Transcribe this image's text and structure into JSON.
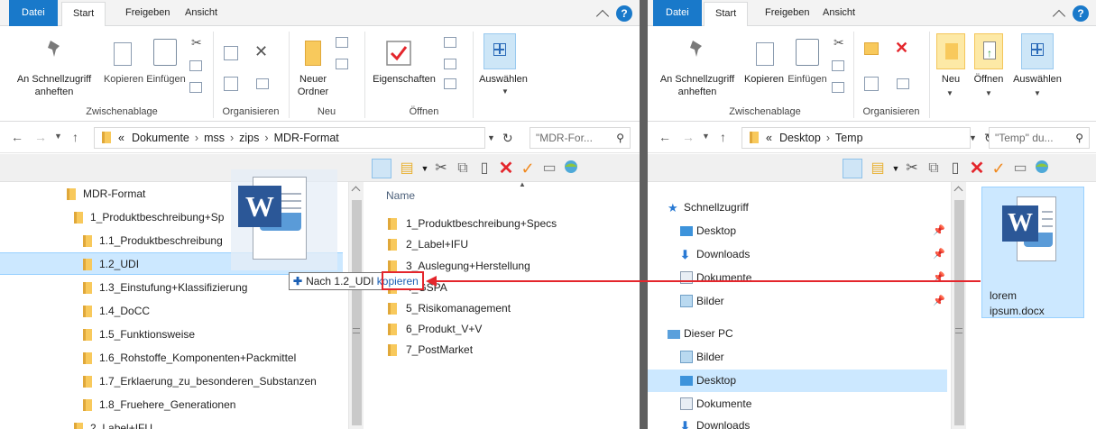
{
  "left": {
    "tabs": [
      "Datei",
      "Start",
      "Freigeben",
      "Ansicht"
    ],
    "ribbon": {
      "pin_label_1": "An Schnellzugriff",
      "pin_label_2": "anheften",
      "copy": "Kopieren",
      "paste": "Einfügen",
      "new_folder_1": "Neuer",
      "new_folder_2": "Ordner",
      "properties": "Eigenschaften",
      "select": "Auswählen",
      "groups": [
        "Zwischenablage",
        "Organisieren",
        "Neu",
        "Öffnen"
      ]
    },
    "address": [
      "«",
      "Dokumente",
      "mss",
      "zips",
      "MDR-Format"
    ],
    "search_placeholder": "\"MDR-For...",
    "tree": [
      "MDR-Format",
      "1_Produktbeschreibung+Sp",
      "1.1_Produktbeschreibung",
      "1.2_UDI",
      "1.3_Einstufung+Klassifizierung",
      "1.4_DoCC",
      "1.5_Funktionsweise",
      "1.6_Rohstoffe_Komponenten+Packmittel",
      "1.7_Erklaerung_zu_besonderen_Substanzen",
      "1.8_Fruehere_Generationen",
      "2_Label+IFU"
    ],
    "column_name": "Name",
    "files": [
      "1_Produktbeschreibung+Specs",
      "2_Label+IFU",
      "3_Auslegung+Herstellung",
      "4_GSPA",
      "5_Risikomanagement",
      "6_Produkt_V+V",
      "7_PostMarket"
    ]
  },
  "right": {
    "tabs": [
      "Datei",
      "Start",
      "Freigeben",
      "Ansicht"
    ],
    "ribbon": {
      "pin_label_1": "An Schnellzugriff",
      "pin_label_2": "anheften",
      "copy": "Kopieren",
      "paste": "Einfügen",
      "new": "Neu",
      "open": "Öffnen",
      "select": "Auswählen",
      "groups": [
        "Zwischenablage",
        "Organisieren"
      ]
    },
    "address": [
      "«",
      "Desktop",
      "Temp"
    ],
    "search_placeholder": "\"Temp\" du...",
    "nav": [
      "Schnellzugriff",
      "Desktop",
      "Downloads",
      "Dokumente",
      "Bilder",
      "Dieser PC",
      "Bilder",
      "Desktop",
      "Dokumente",
      "Downloads"
    ],
    "doc_name_1": "lorem",
    "doc_name_2": "ipsum.docx"
  },
  "drag": {
    "tip_prefix": "Nach 1.2_UDI",
    "tip_action": "kopieren"
  },
  "colors": {
    "file_tab": "#1979ca",
    "selection": "#cce8ff",
    "folder": "#f8c95c",
    "annotation_red": "#e4262c"
  }
}
